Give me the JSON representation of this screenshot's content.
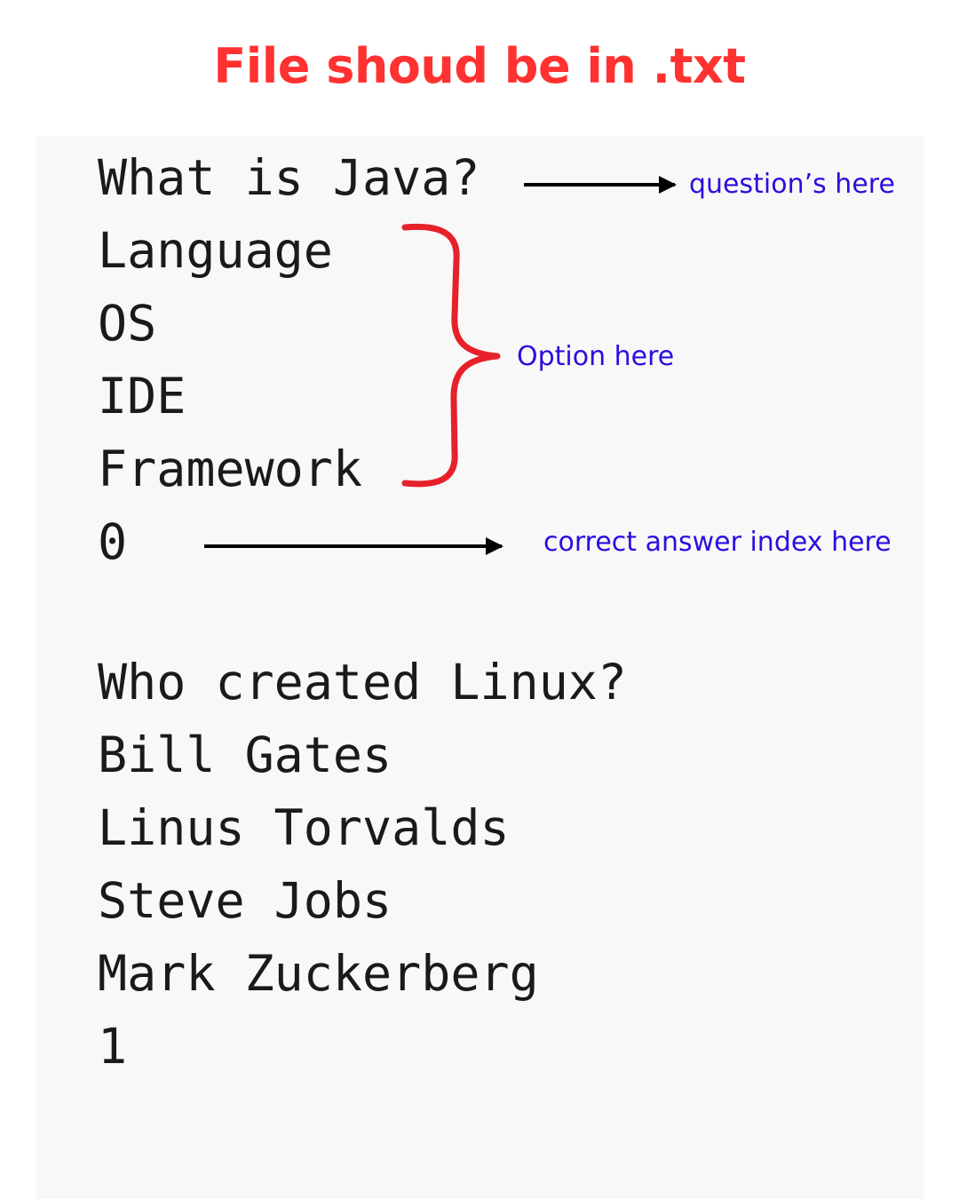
{
  "title": "File shoud be in .txt",
  "file": {
    "lines": [
      "What is Java?",
      "Language",
      "OS",
      "IDE",
      "Framework",
      "0",
      "",
      "Who created Linux?",
      "Bill Gates",
      "Linus Torvalds",
      "Steve Jobs",
      "Mark Zuckerberg",
      "1"
    ]
  },
  "annotations": {
    "question": "question’s here",
    "options": "Option here",
    "answer": "correct answer index here"
  },
  "colors": {
    "title": "#ff3131",
    "annotation_text": "#2a0ee0",
    "brace": "#e8202a",
    "arrow": "#000000",
    "file_text": "#1a1a1a",
    "panel_bg": "#f8f8f8"
  }
}
